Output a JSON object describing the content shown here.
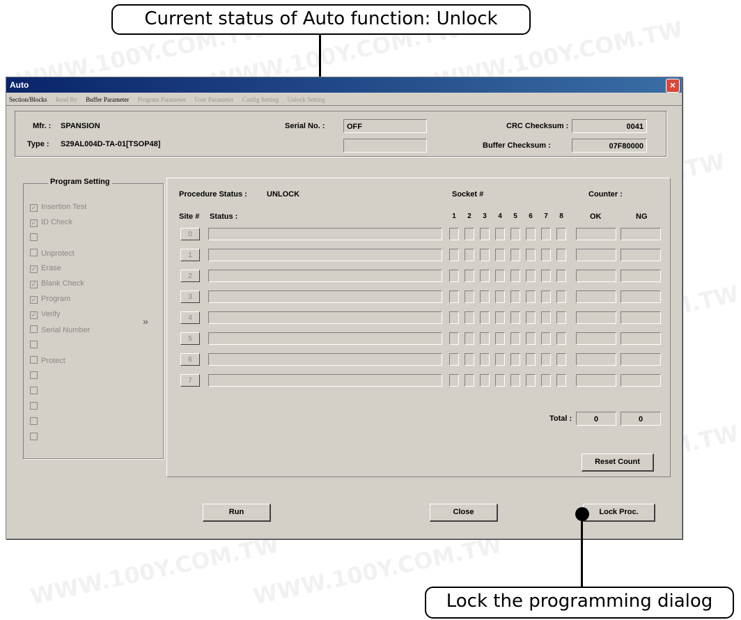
{
  "callouts": {
    "top": "Current status of Auto function: Unlock",
    "bottom": "Lock the programming dialog"
  },
  "window": {
    "title": "Auto",
    "close_icon": "close-icon"
  },
  "tabs": [
    {
      "label": "Section/Blocks",
      "enabled": true
    },
    {
      "label": "Read By",
      "enabled": false
    },
    {
      "label": "Buffer Parameter",
      "enabled": true
    },
    {
      "label": "Program Parameter",
      "enabled": false
    },
    {
      "label": "User Parameter",
      "enabled": false
    },
    {
      "label": "Config Setting",
      "enabled": false
    },
    {
      "label": "Unlock Setting",
      "enabled": false
    }
  ],
  "info": {
    "mfr_label": "Mfr. :",
    "mfr_value": "SPANSION",
    "type_label": "Type :",
    "type_value": "S29AL004D-TA-01[TSOP48]",
    "serial_label": "Serial No. :",
    "serial_value": "OFF",
    "serial_value2": "",
    "crc_label": "CRC Checksum :",
    "crc_value": "0041",
    "buffer_label": "Buffer Checksum :",
    "buffer_value": "07F80000"
  },
  "program_setting": {
    "title": "Program Setting",
    "items": [
      {
        "label": "Insertion Test",
        "checked": true
      },
      {
        "label": "ID Check",
        "checked": true
      },
      {
        "label": "",
        "checked": false
      },
      {
        "label": "Unprotect",
        "checked": false
      },
      {
        "label": "Erase",
        "checked": true
      },
      {
        "label": "Blank Check",
        "checked": true
      },
      {
        "label": "Program",
        "checked": true
      },
      {
        "label": "Verify",
        "checked": true
      },
      {
        "label": "Serial Number",
        "checked": false
      },
      {
        "label": "",
        "checked": false
      },
      {
        "label": "Protect",
        "checked": false
      },
      {
        "label": "",
        "checked": false
      },
      {
        "label": "",
        "checked": false
      },
      {
        "label": "",
        "checked": false
      },
      {
        "label": "",
        "checked": false
      },
      {
        "label": "",
        "checked": false
      }
    ],
    "expand_glyph": "»"
  },
  "procedure": {
    "status_label": "Procedure Status :",
    "status_value": "UNLOCK",
    "socket_label": "Socket #",
    "counter_label": "Counter :",
    "site_label": "Site #",
    "status_col_label": "Status :",
    "sockets": [
      "1",
      "2",
      "3",
      "4",
      "5",
      "6",
      "7",
      "8"
    ],
    "ok_label": "OK",
    "ng_label": "NG",
    "sites": [
      "0",
      "1",
      "2",
      "3",
      "4",
      "5",
      "6",
      "7"
    ],
    "total_label": "Total :",
    "total_ok": "0",
    "total_ng": "0"
  },
  "buttons": {
    "reset": "Reset Count",
    "run": "Run",
    "close": "Close",
    "lock": "Lock Proc."
  },
  "watermark": "WWW.100Y.COM.TW"
}
